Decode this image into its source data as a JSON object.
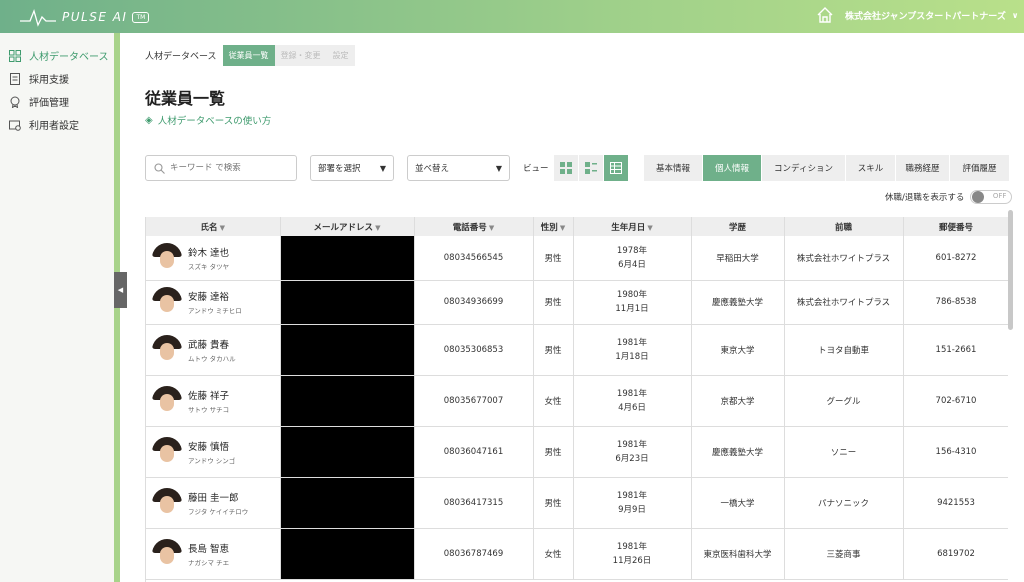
{
  "header": {
    "logo_text": "PULSE AI",
    "logo_badge": "TM",
    "company": "株式会社ジャンプスタートパートナーズ",
    "company_chevron": "∨",
    "home_icon": "home-icon"
  },
  "sidebar": {
    "items": [
      {
        "label": "人材データベース",
        "icon": "grid-icon",
        "active": true
      },
      {
        "label": "採用支援",
        "icon": "document-icon",
        "active": false
      },
      {
        "label": "評価管理",
        "icon": "award-icon",
        "active": false
      },
      {
        "label": "利用者設定",
        "icon": "user-settings-icon",
        "active": false
      }
    ],
    "collapse_glyph": "◀"
  },
  "breadcrumb": {
    "root": "人材データベース",
    "tabs": [
      "従業員一覧",
      "登録・変更",
      "設定"
    ]
  },
  "page": {
    "title": "従業員一覧",
    "help_icon": "◈",
    "help_link": "人材データベースの使い方"
  },
  "filters": {
    "search_placeholder": "キーワード で検索",
    "department_select": "部署を選択",
    "sort_select": "並べ替え",
    "view_label": "ビュー",
    "select_arrow": "▼"
  },
  "info_tabs": [
    "基本情報",
    "個人情報",
    "コンディション",
    "スキル",
    "職務経歴",
    "評価履歴"
  ],
  "toggle": {
    "label": "休職/退職を表示する",
    "state": "OFF"
  },
  "table": {
    "sort_glyph": "▼",
    "columns": [
      {
        "label": "氏名",
        "sortable": true
      },
      {
        "label": "メールアドレス",
        "sortable": true
      },
      {
        "label": "電話番号",
        "sortable": true
      },
      {
        "label": "性別",
        "sortable": true
      },
      {
        "label": "生年月日",
        "sortable": true
      },
      {
        "label": "学歴",
        "sortable": false
      },
      {
        "label": "前職",
        "sortable": false
      },
      {
        "label": "郵便番号",
        "sortable": false
      }
    ],
    "rows": [
      {
        "name": "鈴木 達也",
        "kana": "スズキ タツヤ",
        "phone": "08034566545",
        "gender": "男性",
        "birth_year": "1978年",
        "birth_day": "6月4日",
        "school": "早稲田大学",
        "prev_job": "株式会社ホワイトプラス",
        "postal": "601-8272"
      },
      {
        "name": "安藤 達裕",
        "kana": "アンドウ ミチヒロ",
        "phone": "08034936699",
        "gender": "男性",
        "birth_year": "1980年",
        "birth_day": "11月1日",
        "school": "慶應義塾大学",
        "prev_job": "株式会社ホワイトプラス",
        "postal": "786-8538"
      },
      {
        "name": "武藤 貴春",
        "kana": "ムトウ タカハル",
        "phone": "08035306853",
        "gender": "男性",
        "birth_year": "1981年",
        "birth_day": "1月18日",
        "school": "東京大学",
        "prev_job": "トヨタ自動車",
        "postal": "151-2661"
      },
      {
        "name": "佐藤 祥子",
        "kana": "サトウ サチコ",
        "phone": "08035677007",
        "gender": "女性",
        "birth_year": "1981年",
        "birth_day": "4月6日",
        "school": "京都大学",
        "prev_job": "グーグル",
        "postal": "702-6710"
      },
      {
        "name": "安藤 慎悟",
        "kana": "アンドウ シンゴ",
        "phone": "08036047161",
        "gender": "男性",
        "birth_year": "1981年",
        "birth_day": "6月23日",
        "school": "慶應義塾大学",
        "prev_job": "ソニー",
        "postal": "156-4310"
      },
      {
        "name": "藤田 圭一郎",
        "kana": "フジタ ケイイチロウ",
        "phone": "08036417315",
        "gender": "男性",
        "birth_year": "1981年",
        "birth_day": "9月9日",
        "school": "一橋大学",
        "prev_job": "パナソニック",
        "postal": "9421553"
      },
      {
        "name": "長島 智恵",
        "kana": "ナガシマ チエ",
        "phone": "08036787469",
        "gender": "女性",
        "birth_year": "1981年",
        "birth_day": "11月26日",
        "school": "東京医科歯科大学",
        "prev_job": "三菱商事",
        "postal": "6819702"
      }
    ]
  },
  "colors": {
    "accent": "#6fb08a",
    "sidebar_border": "#a8d38a",
    "link": "#3f9b6e"
  }
}
